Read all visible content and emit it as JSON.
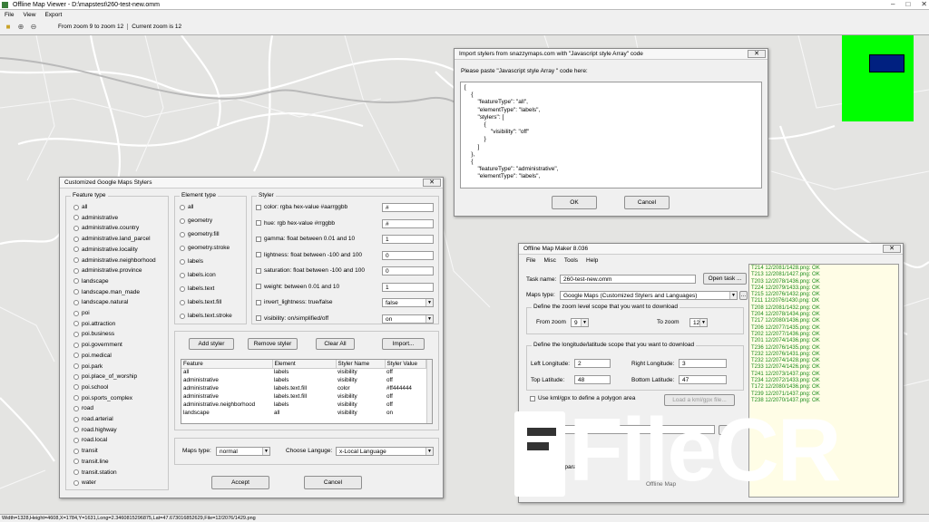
{
  "main": {
    "title": "Offline Map Viewer - D:\\mapstest\\260-test-new.omm",
    "menu": [
      "File",
      "View",
      "Export"
    ],
    "zoom_range": "From zoom 9 to zoom 12",
    "current_zoom": "Current zoom is 12",
    "status": "Width=1328,Height=4608,X=1784,Y=1631,Long=2.3460815296875,Lat=47.673016852629,File=12/2076/1429.png"
  },
  "stylers_dialog": {
    "title": "Customized Google Maps Stylers",
    "feature_type_label": "Feature type",
    "feature_types": [
      "all",
      "administrative",
      "administrative.country",
      "administrative.land_parcel",
      "administrative.locality",
      "administrative.neighborhood",
      "administrative.province",
      "landscape",
      "landscape.man_made",
      "landscape.natural",
      "poi",
      "poi.attraction",
      "poi.business",
      "poi.government",
      "poi.medical",
      "poi.park",
      "poi.place_of_worship",
      "poi.school",
      "poi.sports_complex",
      "road",
      "road.arterial",
      "road.highway",
      "road.local",
      "transit",
      "transit.line",
      "transit.station",
      "water"
    ],
    "element_type_label": "Element type",
    "element_types": [
      "all",
      "geometry",
      "geometry.fill",
      "geometry.stroke",
      "labels",
      "labels.icon",
      "labels.text",
      "labels.text.fill",
      "labels.text.stroke"
    ],
    "styler_label": "Styler",
    "stylers": [
      {
        "label": "color: rgba hex-value #aarrggbb",
        "value": "#"
      },
      {
        "label": "hue: rgb hex-value #rrggbb",
        "value": "#"
      },
      {
        "label": "gamma: float between 0.01 and 10",
        "value": "1"
      },
      {
        "label": "lightness: float between -100 and 100",
        "value": "0"
      },
      {
        "label": "saturation: float between -100 and 100",
        "value": "0"
      },
      {
        "label": "weight: between 0.01 and  10",
        "value": "1"
      },
      {
        "label": "invert_lightness: true/false",
        "value": "false"
      },
      {
        "label": "visibility: on/simplified/off",
        "value": "on"
      }
    ],
    "buttons": {
      "add": "Add styler",
      "remove": "Remove styler",
      "clear": "Clear All",
      "import": "Import..."
    },
    "table": {
      "headers": [
        "Feature",
        "Element",
        "Styler Name",
        "Styler Value"
      ],
      "rows": [
        [
          "all",
          "labels",
          "visibility",
          "off"
        ],
        [
          "administrative",
          "labels",
          "visibility",
          "off"
        ],
        [
          "administrative",
          "labels.text.fill",
          "color",
          "#ff444444"
        ],
        [
          "administrative",
          "labels.text.fill",
          "visibility",
          "off"
        ],
        [
          "administrative.neighborhood",
          "labels",
          "visibility",
          "off"
        ],
        [
          "landscape",
          "all",
          "visibility",
          "on"
        ]
      ]
    },
    "maps_type_label": "Maps type:",
    "maps_type_value": "normal",
    "language_label": "Choose Languge:",
    "language_value": "x-Local Language",
    "accept": "Accept",
    "cancel": "Cancel"
  },
  "import_dialog": {
    "title": "Import stylers from snazzymaps.com with \"Javascript style Array\" code",
    "prompt": "Please paste \"Javascript style Array \" code  here:",
    "code": "[\n    {\n        \"featureType\": \"all\",\n        \"elementType\": \"labels\",\n        \"stylers\": [\n            {\n                \"visibility\": \"off\"\n            }\n        ]\n    },\n    {\n        \"featureType\": \"administrative\",\n        \"elementType\": \"labels\",",
    "ok": "OK",
    "cancel": "Cancel"
  },
  "maker": {
    "title": "Offline Map Maker 8.036",
    "menu": [
      "File",
      "Misc",
      "Tools",
      "Help"
    ],
    "task_name_label": "Task name:",
    "task_name": "260-test-new.omm",
    "open_task": "Open task ...",
    "maps_type_label": "Maps type:",
    "maps_type": "Google Maps (Customized Stylers and Languages)",
    "zoom_group": "Define the zoom level scope that you want to download",
    "from_zoom_label": "From zoom",
    "from_zoom": "9",
    "to_zoom_label": "To zoom",
    "to_zoom": "12",
    "coord_group": "Define the longitude/latitude scope that you want to download",
    "left_lon_label": "Left Longitude:",
    "left_lon": "2",
    "right_lon_label": "Right Longitude:",
    "right_lon": "3",
    "top_lat_label": "Top Latitude:",
    "top_lat": "48",
    "bottom_lat_label": "Bottom Latitude:",
    "bottom_lat": "47",
    "kml_label": "Use kml/gpx to define a polygon area",
    "kml_button": "Load a kml/gpx file...",
    "browse": "...",
    "server_label": "ing server para",
    "more_text": "Offline Map",
    "log": [
      "T214 12/2081/1428.png: OK",
      "T213 12/2081/1427.png: OK",
      "T203 12/2078/1436.png: OK",
      "T224 12/2079/1433.png: OK",
      "T215 12/2076/1432.png: OK",
      "T211 12/2076/1430.png: OK",
      "T208 12/2081/1432.png: OK",
      "T204 12/2078/1434.png: OK",
      "T217 12/2080/1436.png: OK",
      "T206 12/2077/1435.png: OK",
      "T202 12/2077/1436.png: OK",
      "T201 12/2074/1436.png: OK",
      "T236 12/2076/1435.png: OK",
      "T232 12/2076/1431.png: OK",
      "T232 12/2074/1428.png: OK",
      "T233 12/2074/1426.png: OK",
      "T241 12/2073/1437.png: OK",
      "T234 12/2072/1433.png: OK",
      "T172 12/2080/1436.png: OK",
      "T239 12/2071/1437.png: OK",
      "T238 12/2070/1437.png: OK"
    ]
  },
  "watermark": "FileCR",
  "colors": {
    "minimap_bg": "#00ff00",
    "minimap_rect": "#002080",
    "log_text": "#1c8c1c",
    "map_bg": "#e4e4e2"
  }
}
